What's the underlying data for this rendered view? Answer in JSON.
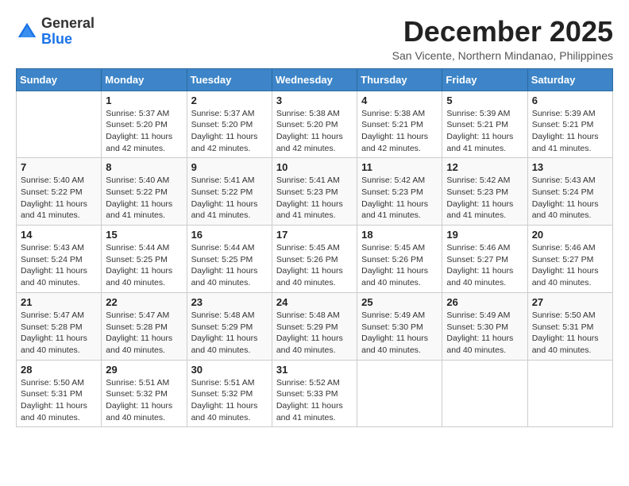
{
  "header": {
    "logo_general": "General",
    "logo_blue": "Blue",
    "month_title": "December 2025",
    "subtitle": "San Vicente, Northern Mindanao, Philippines"
  },
  "weekdays": [
    "Sunday",
    "Monday",
    "Tuesday",
    "Wednesday",
    "Thursday",
    "Friday",
    "Saturday"
  ],
  "weeks": [
    [
      {
        "day": "",
        "info": ""
      },
      {
        "day": "1",
        "info": "Sunrise: 5:37 AM\nSunset: 5:20 PM\nDaylight: 11 hours\nand 42 minutes."
      },
      {
        "day": "2",
        "info": "Sunrise: 5:37 AM\nSunset: 5:20 PM\nDaylight: 11 hours\nand 42 minutes."
      },
      {
        "day": "3",
        "info": "Sunrise: 5:38 AM\nSunset: 5:20 PM\nDaylight: 11 hours\nand 42 minutes."
      },
      {
        "day": "4",
        "info": "Sunrise: 5:38 AM\nSunset: 5:21 PM\nDaylight: 11 hours\nand 42 minutes."
      },
      {
        "day": "5",
        "info": "Sunrise: 5:39 AM\nSunset: 5:21 PM\nDaylight: 11 hours\nand 41 minutes."
      },
      {
        "day": "6",
        "info": "Sunrise: 5:39 AM\nSunset: 5:21 PM\nDaylight: 11 hours\nand 41 minutes."
      }
    ],
    [
      {
        "day": "7",
        "info": "Sunrise: 5:40 AM\nSunset: 5:22 PM\nDaylight: 11 hours\nand 41 minutes."
      },
      {
        "day": "8",
        "info": "Sunrise: 5:40 AM\nSunset: 5:22 PM\nDaylight: 11 hours\nand 41 minutes."
      },
      {
        "day": "9",
        "info": "Sunrise: 5:41 AM\nSunset: 5:22 PM\nDaylight: 11 hours\nand 41 minutes."
      },
      {
        "day": "10",
        "info": "Sunrise: 5:41 AM\nSunset: 5:23 PM\nDaylight: 11 hours\nand 41 minutes."
      },
      {
        "day": "11",
        "info": "Sunrise: 5:42 AM\nSunset: 5:23 PM\nDaylight: 11 hours\nand 41 minutes."
      },
      {
        "day": "12",
        "info": "Sunrise: 5:42 AM\nSunset: 5:23 PM\nDaylight: 11 hours\nand 41 minutes."
      },
      {
        "day": "13",
        "info": "Sunrise: 5:43 AM\nSunset: 5:24 PM\nDaylight: 11 hours\nand 40 minutes."
      }
    ],
    [
      {
        "day": "14",
        "info": "Sunrise: 5:43 AM\nSunset: 5:24 PM\nDaylight: 11 hours\nand 40 minutes."
      },
      {
        "day": "15",
        "info": "Sunrise: 5:44 AM\nSunset: 5:25 PM\nDaylight: 11 hours\nand 40 minutes."
      },
      {
        "day": "16",
        "info": "Sunrise: 5:44 AM\nSunset: 5:25 PM\nDaylight: 11 hours\nand 40 minutes."
      },
      {
        "day": "17",
        "info": "Sunrise: 5:45 AM\nSunset: 5:26 PM\nDaylight: 11 hours\nand 40 minutes."
      },
      {
        "day": "18",
        "info": "Sunrise: 5:45 AM\nSunset: 5:26 PM\nDaylight: 11 hours\nand 40 minutes."
      },
      {
        "day": "19",
        "info": "Sunrise: 5:46 AM\nSunset: 5:27 PM\nDaylight: 11 hours\nand 40 minutes."
      },
      {
        "day": "20",
        "info": "Sunrise: 5:46 AM\nSunset: 5:27 PM\nDaylight: 11 hours\nand 40 minutes."
      }
    ],
    [
      {
        "day": "21",
        "info": "Sunrise: 5:47 AM\nSunset: 5:28 PM\nDaylight: 11 hours\nand 40 minutes."
      },
      {
        "day": "22",
        "info": "Sunrise: 5:47 AM\nSunset: 5:28 PM\nDaylight: 11 hours\nand 40 minutes."
      },
      {
        "day": "23",
        "info": "Sunrise: 5:48 AM\nSunset: 5:29 PM\nDaylight: 11 hours\nand 40 minutes."
      },
      {
        "day": "24",
        "info": "Sunrise: 5:48 AM\nSunset: 5:29 PM\nDaylight: 11 hours\nand 40 minutes."
      },
      {
        "day": "25",
        "info": "Sunrise: 5:49 AM\nSunset: 5:30 PM\nDaylight: 11 hours\nand 40 minutes."
      },
      {
        "day": "26",
        "info": "Sunrise: 5:49 AM\nSunset: 5:30 PM\nDaylight: 11 hours\nand 40 minutes."
      },
      {
        "day": "27",
        "info": "Sunrise: 5:50 AM\nSunset: 5:31 PM\nDaylight: 11 hours\nand 40 minutes."
      }
    ],
    [
      {
        "day": "28",
        "info": "Sunrise: 5:50 AM\nSunset: 5:31 PM\nDaylight: 11 hours\nand 40 minutes."
      },
      {
        "day": "29",
        "info": "Sunrise: 5:51 AM\nSunset: 5:32 PM\nDaylight: 11 hours\nand 40 minutes."
      },
      {
        "day": "30",
        "info": "Sunrise: 5:51 AM\nSunset: 5:32 PM\nDaylight: 11 hours\nand 40 minutes."
      },
      {
        "day": "31",
        "info": "Sunrise: 5:52 AM\nSunset: 5:33 PM\nDaylight: 11 hours\nand 41 minutes."
      },
      {
        "day": "",
        "info": ""
      },
      {
        "day": "",
        "info": ""
      },
      {
        "day": "",
        "info": ""
      }
    ]
  ]
}
